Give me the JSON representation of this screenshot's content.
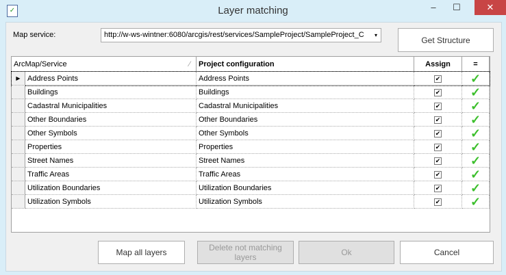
{
  "window": {
    "title": "Layer matching",
    "minimize": "‒",
    "maximize": "☐",
    "close": "✕"
  },
  "map_service": {
    "label": "Map service:",
    "value": "http://w-ws-wintner:6080/arcgis/rest/services/SampleProject/SampleProject_C",
    "arrow": "▾"
  },
  "buttons": {
    "get_structure": "Get Structure",
    "map_all": "Map all layers",
    "delete_not_matching": "Delete not matching layers",
    "ok": "Ok",
    "cancel": "Cancel"
  },
  "grid": {
    "headers": [
      "ArcMap/Service",
      "Project configuration",
      "Assign",
      "="
    ],
    "sort_glyph": "⁄",
    "current_marker": "▶",
    "check": "✔",
    "match": "✓",
    "rows": [
      {
        "service": "Address Points",
        "config": "Address Points",
        "assign": true,
        "match": true
      },
      {
        "service": "Buildings",
        "config": "Buildings",
        "assign": true,
        "match": true
      },
      {
        "service": "Cadastral Municipalities",
        "config": "Cadastral Municipalities",
        "assign": true,
        "match": true
      },
      {
        "service": "Other Boundaries",
        "config": "Other Boundaries",
        "assign": true,
        "match": true
      },
      {
        "service": "Other Symbols",
        "config": "Other Symbols",
        "assign": true,
        "match": true
      },
      {
        "service": "Properties",
        "config": "Properties",
        "assign": true,
        "match": true
      },
      {
        "service": "Street Names",
        "config": "Street Names",
        "assign": true,
        "match": true
      },
      {
        "service": "Traffic Areas",
        "config": "Traffic Areas",
        "assign": true,
        "match": true
      },
      {
        "service": "Utilization Boundaries",
        "config": "Utilization Boundaries",
        "assign": true,
        "match": true
      },
      {
        "service": "Utilization Symbols",
        "config": "Utilization Symbols",
        "assign": true,
        "match": true
      }
    ]
  }
}
